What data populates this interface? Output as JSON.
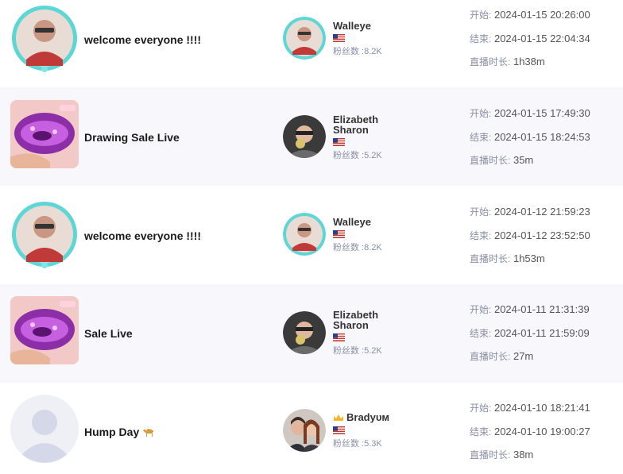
{
  "labels": {
    "start": "开始:",
    "end": "结束:",
    "duration": "直播时长:",
    "followers_prefix": "粉丝数 :"
  },
  "streams": [
    {
      "title": "welcome everyone !!!!",
      "host_name": "Walleye",
      "host_name_line2": "",
      "followers": "8.2K",
      "start": "2024-01-15 20:26:00",
      "end": "2024-01-15 22:04:34",
      "duration": "1h38m"
    },
    {
      "title": "Drawing Sale Live",
      "host_name": "Elizabeth",
      "host_name_line2": "Sharon",
      "followers": "5.2K",
      "start": "2024-01-15 17:49:30",
      "end": "2024-01-15 18:24:53",
      "duration": "35m"
    },
    {
      "title": "welcome everyone !!!!",
      "host_name": "Walleye",
      "host_name_line2": "",
      "followers": "8.2K",
      "start": "2024-01-12 21:59:23",
      "end": "2024-01-12 23:52:50",
      "duration": "1h53m"
    },
    {
      "title": "Sale Live",
      "host_name": "Elizabeth",
      "host_name_line2": "Sharon",
      "followers": "5.2K",
      "start": "2024-01-11 21:31:39",
      "end": "2024-01-11 21:59:09",
      "duration": "27m"
    },
    {
      "title": "Hump Day",
      "host_name": "Bradyᴜᴍ",
      "host_name_line2": "",
      "followers": "5.3K",
      "start": "2024-01-10 18:21:41",
      "end": "2024-01-10 19:00:27",
      "duration": "38m"
    }
  ]
}
